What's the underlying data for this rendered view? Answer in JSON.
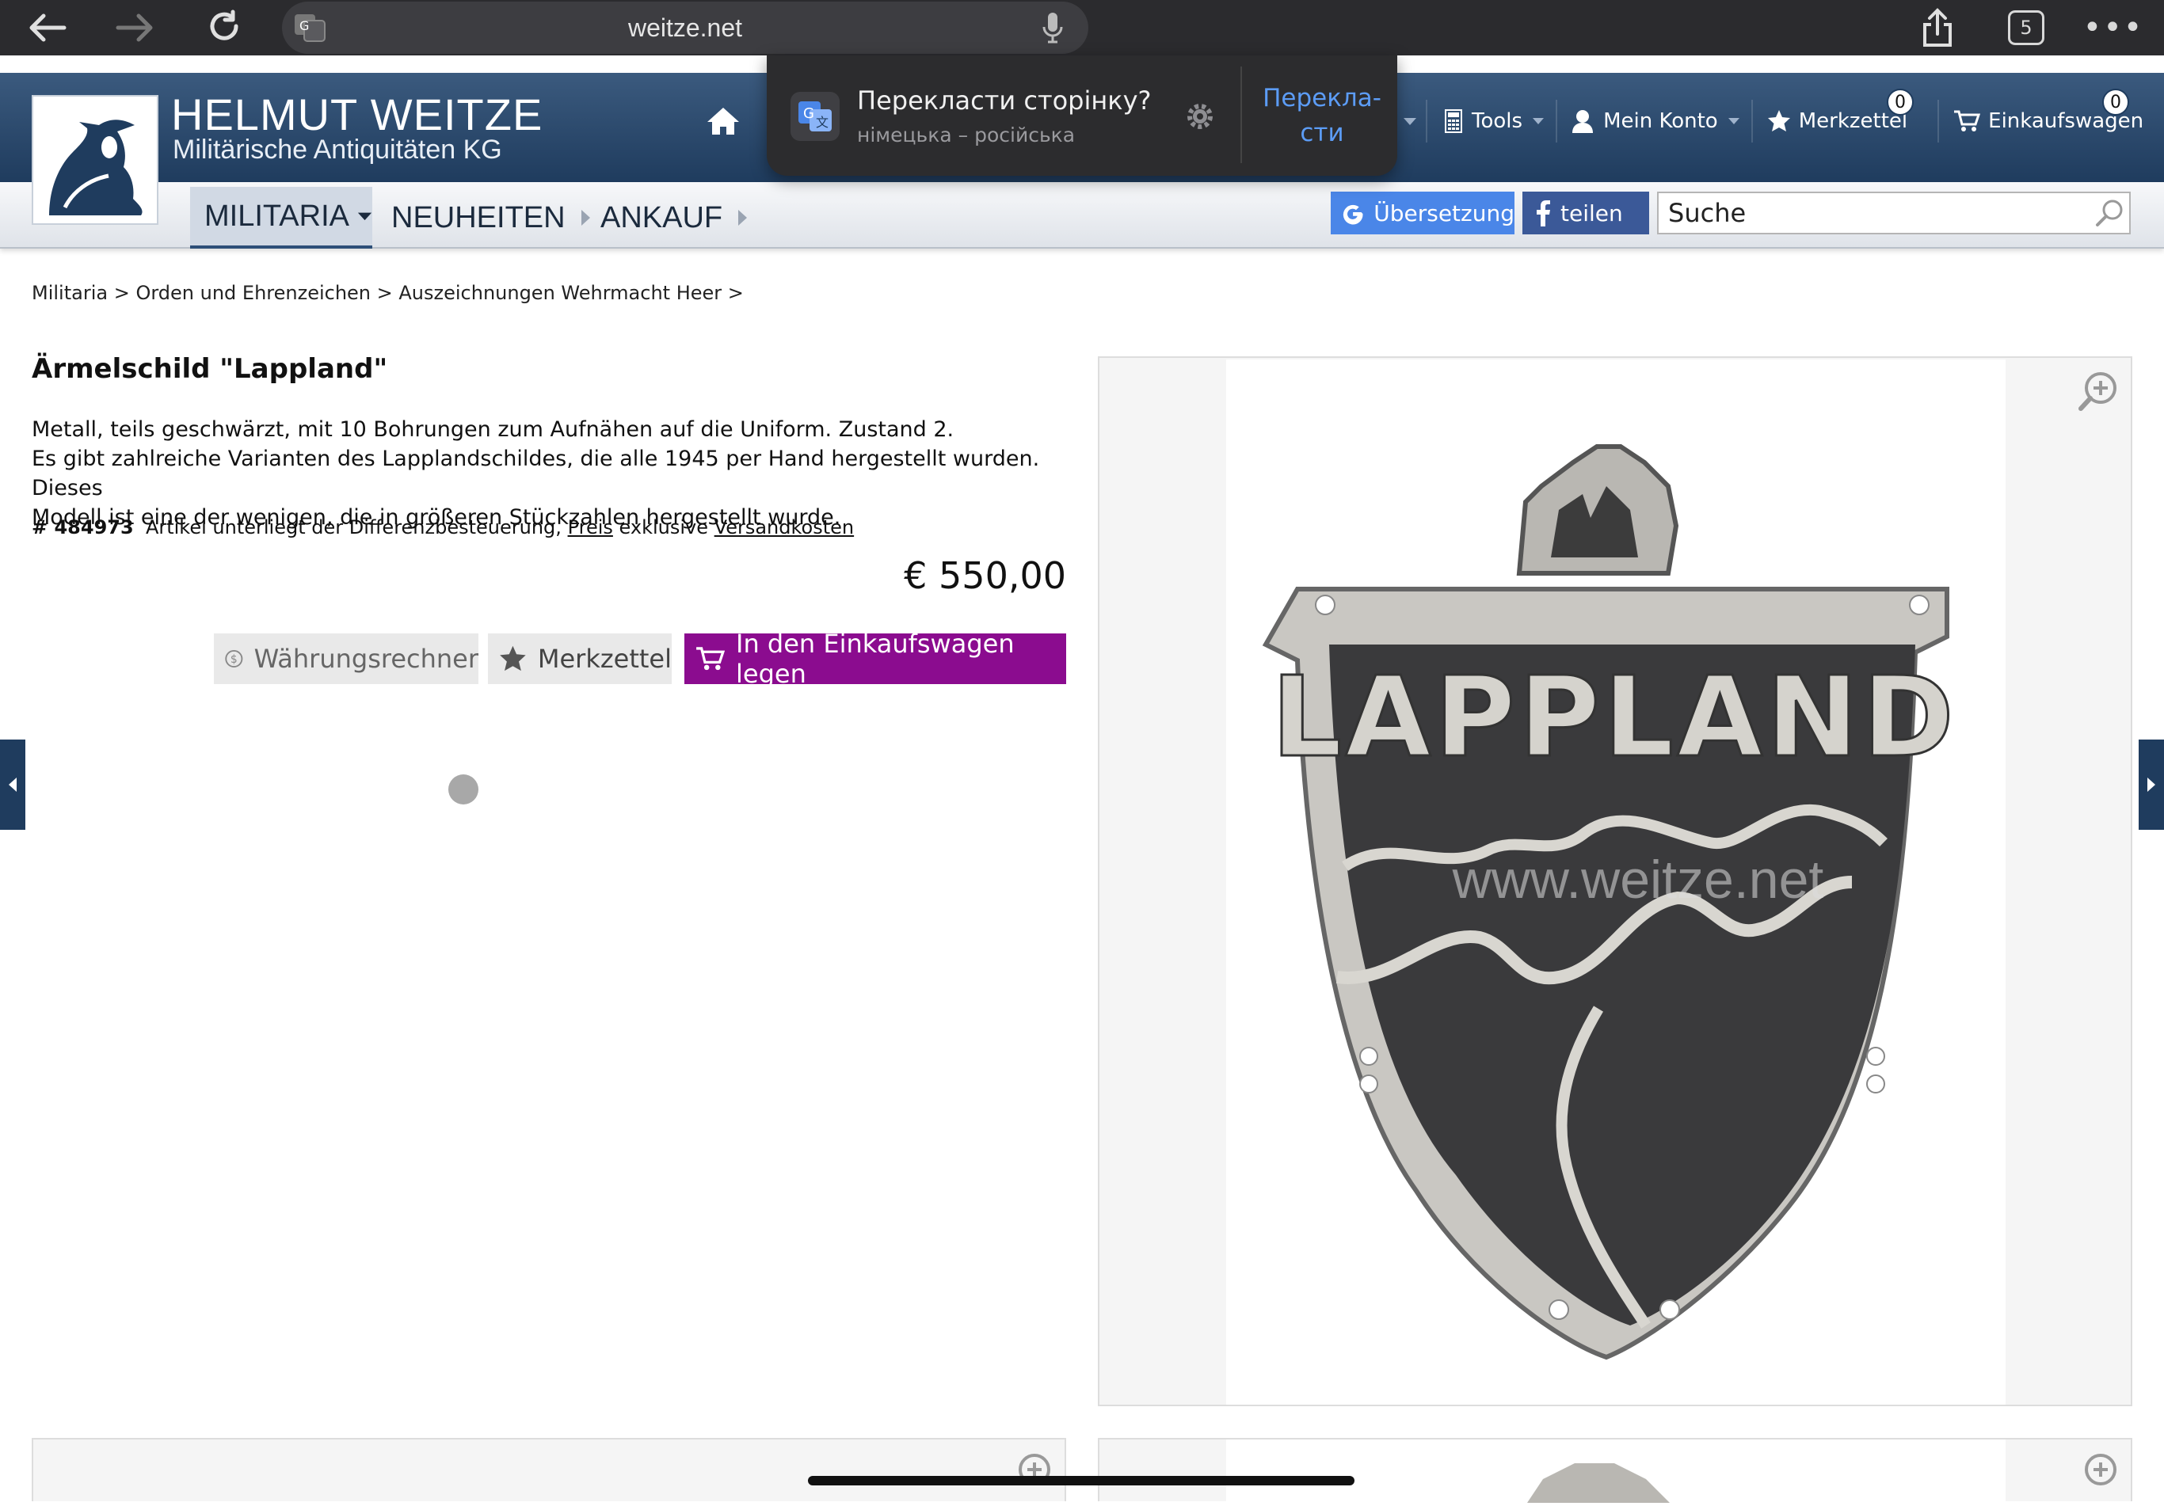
{
  "browser": {
    "url": "weitze.net",
    "tab_count": "5"
  },
  "translate_popup": {
    "title": "Перекласти сторінку?",
    "subtitle": "німецька – російська",
    "action_line1": "Перекла-",
    "action_line2": "сти"
  },
  "site": {
    "brand_title": "HELMUT WEITZE",
    "brand_subtitle": "Militärische Antiquitäten KG"
  },
  "top_nav": {
    "tools": "Tools",
    "account": "Mein Konto",
    "wishlist": "Merkzettel",
    "wishlist_count": "0",
    "cart": "Einkaufswagen",
    "cart_count": "0"
  },
  "main_nav": {
    "items": [
      "MILITARIA",
      "NEUHEITEN",
      "ANKAUF"
    ],
    "translate_label": "Übersetzung",
    "share_label": "teilen",
    "search_value": "Suche"
  },
  "breadcrumb": "Militaria > Orden und Ehrenzeichen > Auszeichnungen Wehrmacht Heer >",
  "product": {
    "title": "Ärmelschild \"Lappland\"",
    "desc_line1": "Metall, teils geschwärzt, mit 10 Bohrungen zum Aufnähen auf die Uniform. Zustand 2.",
    "desc_line2": "Es gibt zahlreiche Varianten des Lapplandschildes, die alle 1945 per Hand hergestellt wurden. Dieses",
    "desc_line3": "Modell ist eine der wenigen, die in größeren Stückzahlen hergestellt wurde.",
    "id": "# 484973",
    "tax_note": "Artikel unterliegt der Differenzbesteuerung,",
    "price_link": "Preis",
    "excl": "exklusive",
    "shipping_link": "Versandkosten",
    "price": "€ 550,00",
    "currency_button": "Währungsrechner",
    "wishlist_button": "Merkzettel",
    "cart_button": "In den Einkaufswagen legen",
    "image_text": "LAPPLAND",
    "watermark": "www.weitze.net"
  },
  "colors": {
    "header": "#2a4a6e",
    "cart_button": "#8b0c8f",
    "translate": "#4a86e8",
    "facebook": "#3b5998"
  }
}
